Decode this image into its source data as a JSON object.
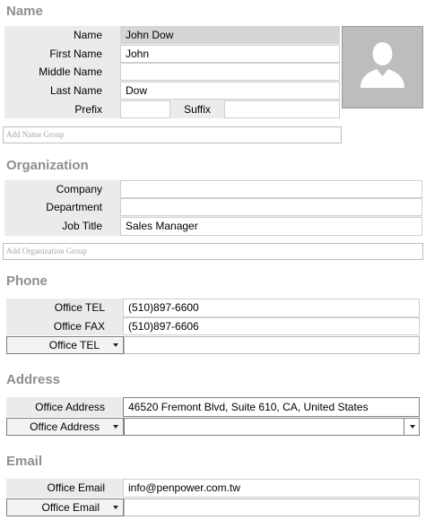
{
  "sections": {
    "name": "Name",
    "organization": "Organization",
    "phone": "Phone",
    "address": "Address",
    "email": "Email"
  },
  "name": {
    "labels": {
      "name": "Name",
      "first": "First Name",
      "middle": "Middle Name",
      "last": "Last Name",
      "prefix": "Prefix",
      "suffix": "Suffix"
    },
    "values": {
      "name": "John Dow",
      "first": "John",
      "middle": "",
      "last": "Dow",
      "prefix": "",
      "suffix": ""
    },
    "add_group_placeholder": "Add Name Group"
  },
  "organization": {
    "labels": {
      "company": "Company",
      "department": "Department",
      "job_title": "Job Title"
    },
    "values": {
      "company": "",
      "department": "",
      "job_title": "Sales Manager"
    },
    "add_group_placeholder": "Add Organization Group"
  },
  "phone": {
    "rows": [
      {
        "label": "Office TEL",
        "value": "(510)897-6600"
      },
      {
        "label": "Office FAX",
        "value": "(510)897-6606"
      }
    ],
    "new_type": "Office TEL",
    "new_value": ""
  },
  "address": {
    "label": "Office Address",
    "value": "46520 Fremont Blvd, Suite 610, CA, United States",
    "new_type": "Office Address",
    "new_value": ""
  },
  "email": {
    "label": "Office Email",
    "value": "info@penpower.com.tw",
    "new_type": "Office Email",
    "new_value": ""
  },
  "icons": {
    "avatar": "person-silhouette-icon",
    "dropdown": "triangle-down-icon"
  },
  "colors": {
    "section_title": "#8e8e8e",
    "label_bg": "#ebebeb",
    "avatar_bg": "#bdbdbd"
  }
}
